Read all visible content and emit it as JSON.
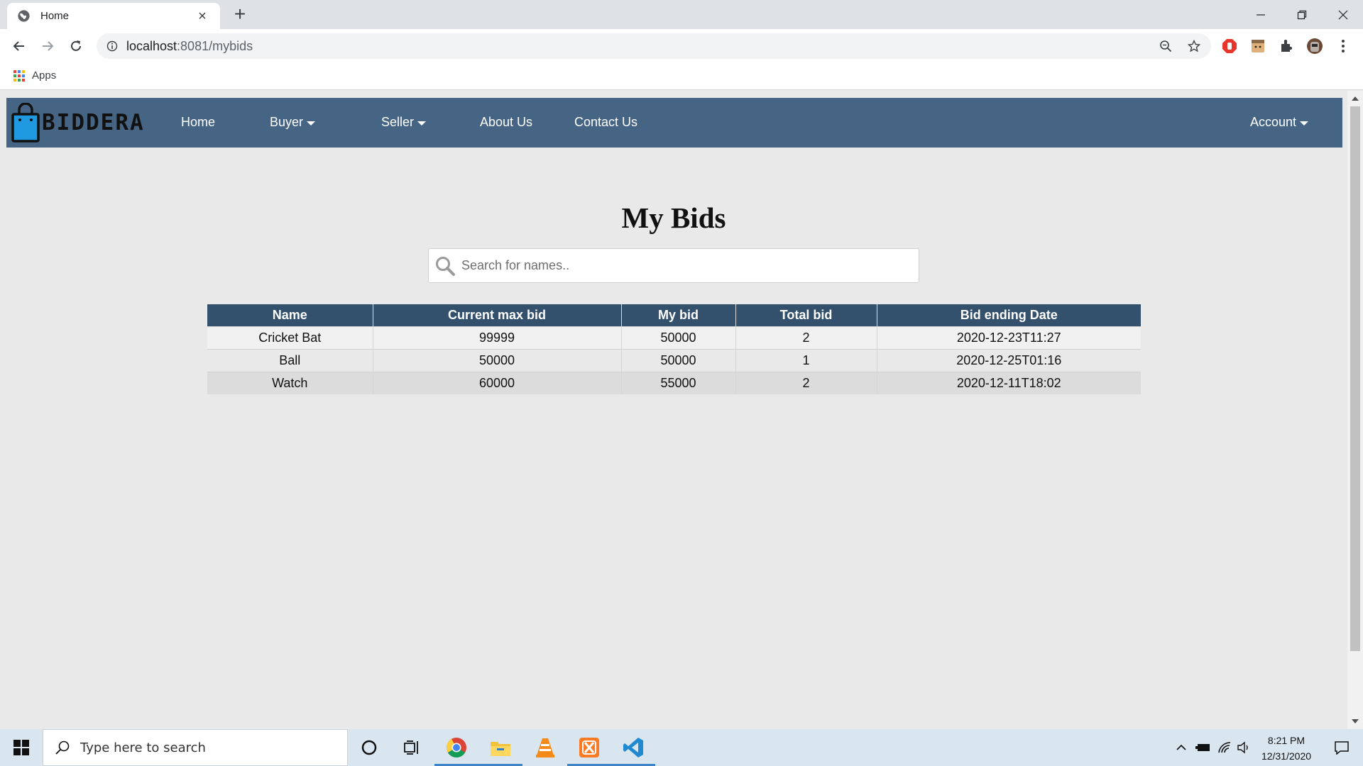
{
  "browser": {
    "tab_title": "Home",
    "close_tab_label": "×",
    "new_tab_label": "+",
    "url_host": "localhost",
    "url_rest": ":8081/mybids",
    "bookmarks_apps_label": "Apps",
    "icons": [
      "globe-icon",
      "back-icon",
      "forward-icon",
      "reload-icon",
      "info-icon",
      "zoom-icon",
      "star-icon",
      "extensions-icon",
      "menu-icon",
      "minimize-icon",
      "restore-icon",
      "close-icon"
    ]
  },
  "site": {
    "logo_text": "BIDDERA",
    "nav": {
      "home": "Home",
      "buyer": "Buyer",
      "seller": "Seller",
      "about": "About Us",
      "contact": "Contact Us",
      "account": "Account"
    },
    "colors": {
      "navbar": "#466585",
      "table_header": "#33506d",
      "page_bg": "#e9e9e9"
    }
  },
  "main": {
    "title": "My Bids",
    "search_placeholder": "Search for names..",
    "table": {
      "headers": [
        "Name",
        "Current max bid",
        "My bid",
        "Total bid",
        "Bid ending Date"
      ],
      "rows": [
        [
          "Cricket Bat",
          "99999",
          "50000",
          "2",
          "2020-12-23T11:27"
        ],
        [
          "Ball",
          "50000",
          "50000",
          "1",
          "2020-12-25T01:16"
        ],
        [
          "Watch",
          "60000",
          "55000",
          "2",
          "2020-12-11T18:02"
        ]
      ]
    }
  },
  "taskbar": {
    "search_text": "Type here to search",
    "time": "8:21 PM",
    "date": "12/31/2020"
  }
}
